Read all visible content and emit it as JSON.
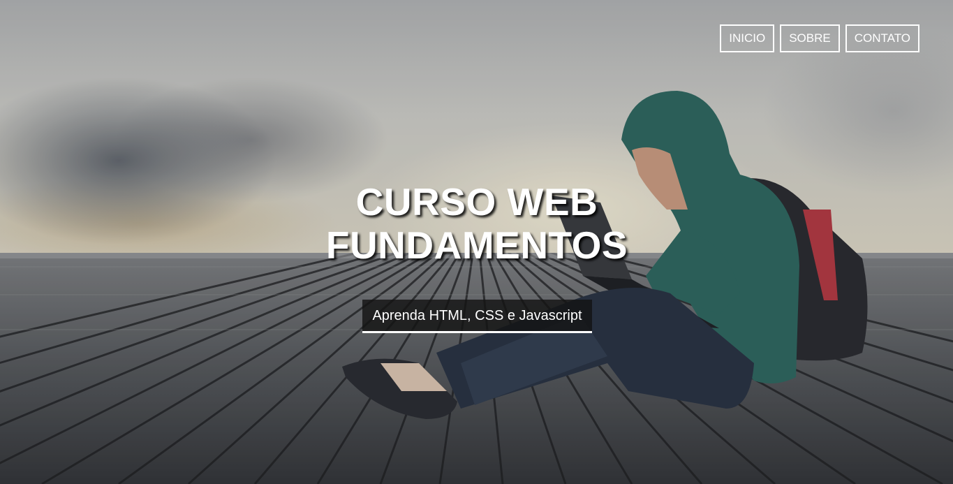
{
  "nav": {
    "items": [
      {
        "label": "INICIO"
      },
      {
        "label": "SOBRE"
      },
      {
        "label": "CONTATO"
      }
    ]
  },
  "hero": {
    "title_line1": "CURSO WEB",
    "title_line2": "FUNDAMENTOS",
    "subtitle": "Aprenda HTML, CSS e Javascript"
  }
}
